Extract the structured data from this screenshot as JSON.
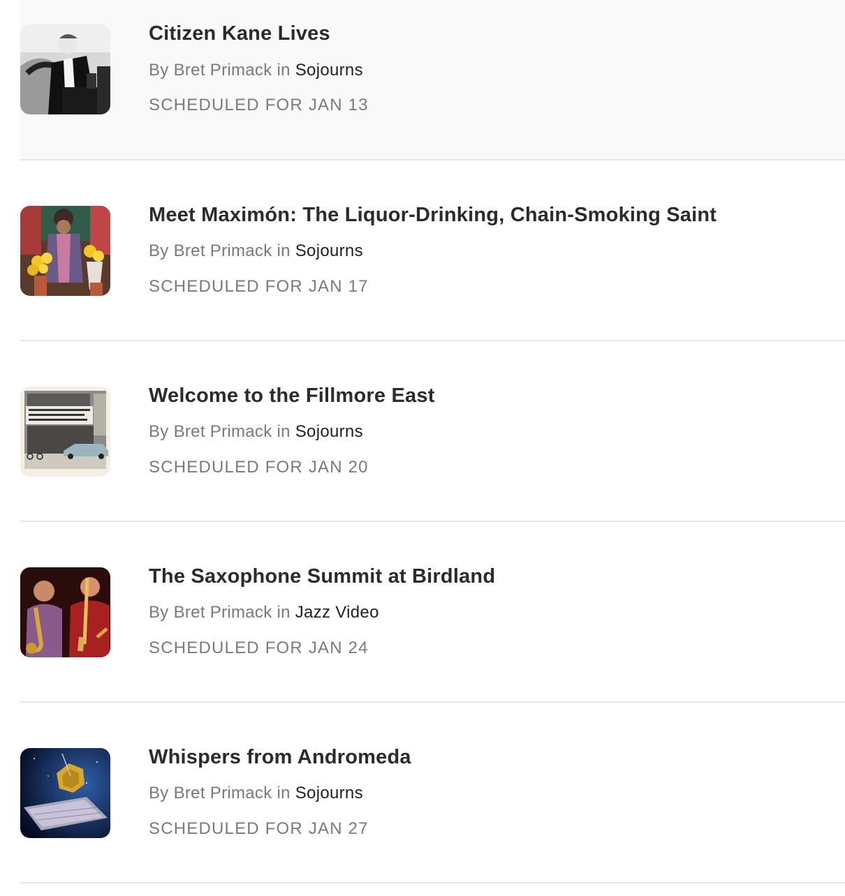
{
  "posts": [
    {
      "title": "Citizen Kane Lives",
      "by_prefix": "By Bret Primack",
      "in_word": "in",
      "publication": "Sojourns",
      "schedule": "SCHEDULED FOR JAN 13",
      "thumb_icon": "citizen-kane-photo-icon"
    },
    {
      "title": "Meet Maximón: The Liquor-Drinking, Chain-Smoking Saint",
      "by_prefix": "By Bret Primack",
      "in_word": "in",
      "publication": "Sojourns",
      "schedule": "SCHEDULED FOR JAN 17",
      "thumb_icon": "maximon-shrine-photo-icon"
    },
    {
      "title": "Welcome to the Fillmore East",
      "by_prefix": "By Bret Primack",
      "in_word": "in",
      "publication": "Sojourns",
      "schedule": "SCHEDULED FOR JAN 20",
      "thumb_icon": "fillmore-east-marquee-photo-icon"
    },
    {
      "title": "The Saxophone Summit at Birdland",
      "by_prefix": "By Bret Primack",
      "in_word": "in",
      "publication": "Jazz Video",
      "schedule": "SCHEDULED FOR JAN 24",
      "thumb_icon": "saxophonists-photo-icon"
    },
    {
      "title": "Whispers from Andromeda",
      "by_prefix": "By Bret Primack",
      "in_word": "in",
      "publication": "Sojourns",
      "schedule": "SCHEDULED FOR JAN 27",
      "thumb_icon": "space-telescope-photo-icon"
    }
  ],
  "colors": {
    "title": "#2b2b2b",
    "meta": "#7a7a7a",
    "publication": "#222222",
    "divider": "#e6e6e6",
    "highlight_row": "#f9f9f9"
  }
}
